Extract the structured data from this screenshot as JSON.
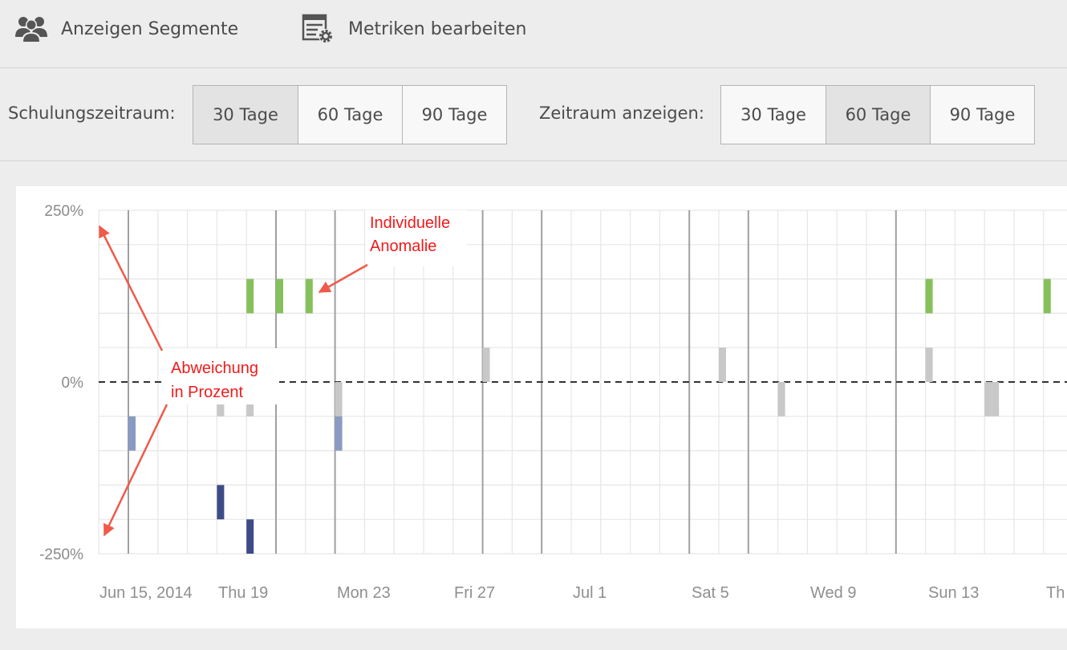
{
  "toolbar": {
    "segments_label": "Anzeigen Segmente",
    "metrics_label": "Metriken bearbeiten",
    "segments_icon": "users-icon",
    "metrics_icon": "table-settings-icon"
  },
  "training_period": {
    "label": "Schulungszeitraum:",
    "options": [
      "30 Tage",
      "60 Tage",
      "90 Tage"
    ],
    "selected": "30 Tage"
  },
  "display_period": {
    "label": "Zeitraum anzeigen:",
    "options": [
      "30 Tage",
      "60 Tage",
      "90 Tage"
    ],
    "selected": "60 Tage"
  },
  "annotations": {
    "individual_anomaly": [
      "Individuelle",
      "Anomalie"
    ],
    "deviation": [
      "Abweichung",
      "in Prozent"
    ]
  },
  "colors": {
    "positive_anomaly": "#85c15a",
    "neutral": "#c8c8c8",
    "negative_light": "#8a9ac2",
    "negative_dark": "#3d4b86",
    "annotation": "#ef1b1b"
  },
  "chart_data": {
    "type": "bar",
    "y_ticks": [
      "250%",
      "0%",
      "-250%"
    ],
    "ylim": [
      -250,
      250
    ],
    "y_unit": "%",
    "x_ticks": [
      "Jun 15, 2014",
      "Thu 19",
      "Mon 23",
      "Fri 27",
      "Jul 1",
      "Sat 5",
      "Wed 9",
      "Sun 13",
      "Th"
    ],
    "x_start_date": "2014-06-15",
    "grid": true,
    "zero_line": "dashed",
    "bars": [
      {
        "date": "2014-06-15",
        "from": -50,
        "to": -100,
        "color": "negative_light"
      },
      {
        "date": "2014-06-18",
        "from": -50,
        "to": 0,
        "color": "neutral"
      },
      {
        "date": "2014-06-18",
        "from": -150,
        "to": -200,
        "color": "negative_dark"
      },
      {
        "date": "2014-06-19",
        "from": 100,
        "to": 150,
        "color": "positive_anomaly"
      },
      {
        "date": "2014-06-19",
        "from": -50,
        "to": 0,
        "color": "neutral"
      },
      {
        "date": "2014-06-19",
        "from": -200,
        "to": -250,
        "color": "negative_dark"
      },
      {
        "date": "2014-06-20",
        "from": 100,
        "to": 150,
        "color": "positive_anomaly"
      },
      {
        "date": "2014-06-21",
        "from": 100,
        "to": 150,
        "color": "positive_anomaly"
      },
      {
        "date": "2014-06-22",
        "from": -50,
        "to": 0,
        "color": "neutral"
      },
      {
        "date": "2014-06-22",
        "from": -50,
        "to": -100,
        "color": "negative_light"
      },
      {
        "date": "2014-06-27",
        "from": 0,
        "to": 50,
        "color": "neutral"
      },
      {
        "date": "2014-07-05",
        "from": 0,
        "to": 50,
        "color": "neutral"
      },
      {
        "date": "2014-07-07",
        "from": -50,
        "to": 0,
        "color": "neutral"
      },
      {
        "date": "2014-07-12",
        "from": 100,
        "to": 150,
        "color": "positive_anomaly"
      },
      {
        "date": "2014-07-12",
        "from": 0,
        "to": 50,
        "color": "neutral"
      },
      {
        "date": "2014-07-14",
        "from": -50,
        "to": 0,
        "color": "neutral"
      },
      {
        "date": "2014-07-14",
        "from": -50,
        "to": 0,
        "color": "neutral"
      },
      {
        "date": "2014-07-16",
        "from": 100,
        "to": 150,
        "color": "positive_anomaly"
      }
    ]
  }
}
